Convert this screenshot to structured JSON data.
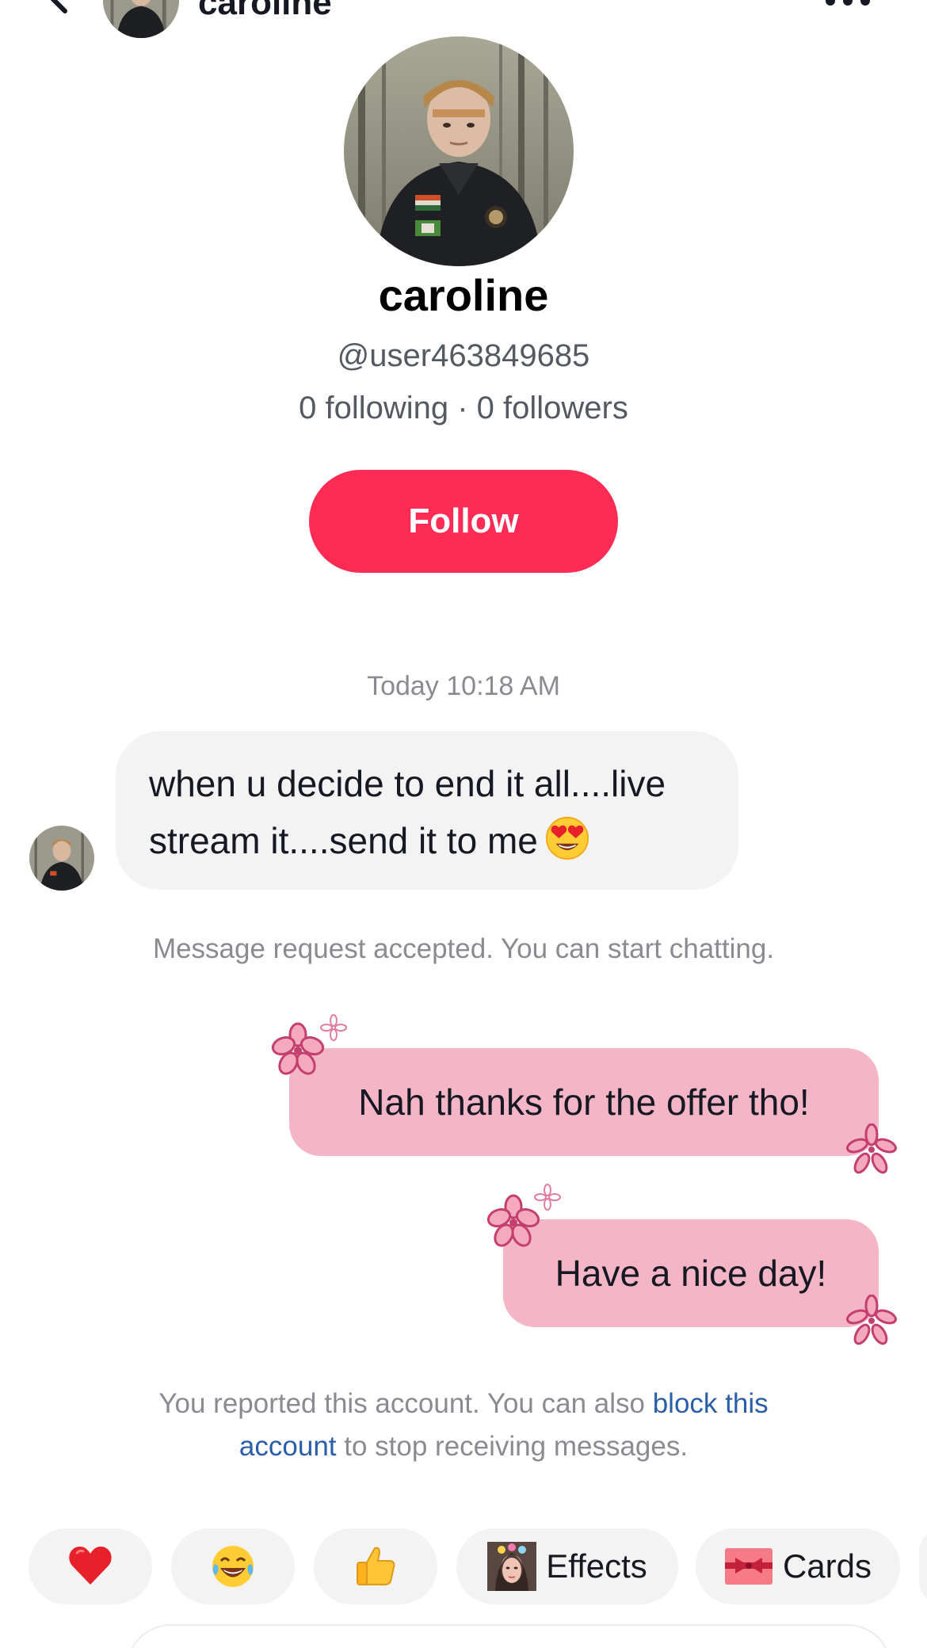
{
  "header": {
    "name": "caroline",
    "back_icon": "chevron-left-icon",
    "more_icon": "ellipsis-icon"
  },
  "profile": {
    "name": "caroline",
    "handle": "@user463849685",
    "stats": "0 following · 0 followers",
    "follow_label": "Follow",
    "follow_color": "#fe2c55"
  },
  "chat": {
    "timestamp": "Today 10:18 AM",
    "incoming": {
      "line1": "when u decide to end it all....live",
      "line2": "stream it....send it to me",
      "emoji": "heart-eyes-emoji"
    },
    "system_note": "Message request accepted. You can start chatting.",
    "outgoing": [
      {
        "text": "Nah thanks for the offer tho!"
      },
      {
        "text": "Have a nice day!"
      }
    ],
    "bubble_color": "#f4b6c7",
    "report_note_before": "You reported this account. You can also ",
    "report_note_link": "block this account",
    "report_note_after": " to stop receiving messages.",
    "link_color": "#2b5ea8"
  },
  "quick_bar": {
    "items": [
      {
        "icon": "red-heart-emoji"
      },
      {
        "icon": "laughing-crying-emoji"
      },
      {
        "icon": "thumbs-up-emoji"
      },
      {
        "icon": "effects-thumbnail",
        "label": "Effects"
      },
      {
        "icon": "gift-card-icon",
        "label": "Cards"
      }
    ]
  }
}
